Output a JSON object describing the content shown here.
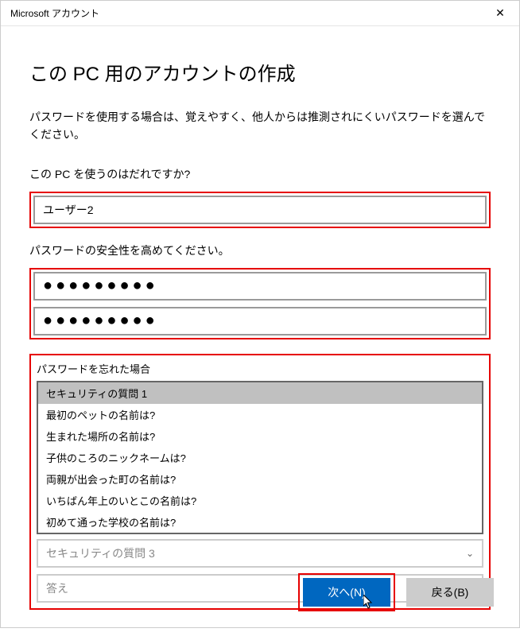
{
  "titlebar": {
    "title": "Microsoft アカウント"
  },
  "heading": "この PC 用のアカウントの作成",
  "description": "パスワードを使用する場合は、覚えやすく、他人からは推測されにくいパスワードを選んでください。",
  "username": {
    "label": "この PC を使うのはだれですか?",
    "value": "ユーザー2"
  },
  "password": {
    "label": "パスワードの安全性を高めてください。",
    "value1": "●●●●●●●●●",
    "value2": "●●●●●●●●●"
  },
  "forgot": {
    "label": "パスワードを忘れた場合",
    "dropdown_items": [
      "セキュリティの質問 1",
      "最初のペットの名前は?",
      "生まれた場所の名前は?",
      "子供のころのニックネームは?",
      "両親が出会った町の名前は?",
      "いちばん年上のいとこの名前は?",
      "初めて通った学校の名前は?"
    ],
    "question3_placeholder": "セキュリティの質問 3",
    "answer_placeholder": "答え"
  },
  "buttons": {
    "next": "次へ(N)",
    "back": "戻る(B)"
  }
}
